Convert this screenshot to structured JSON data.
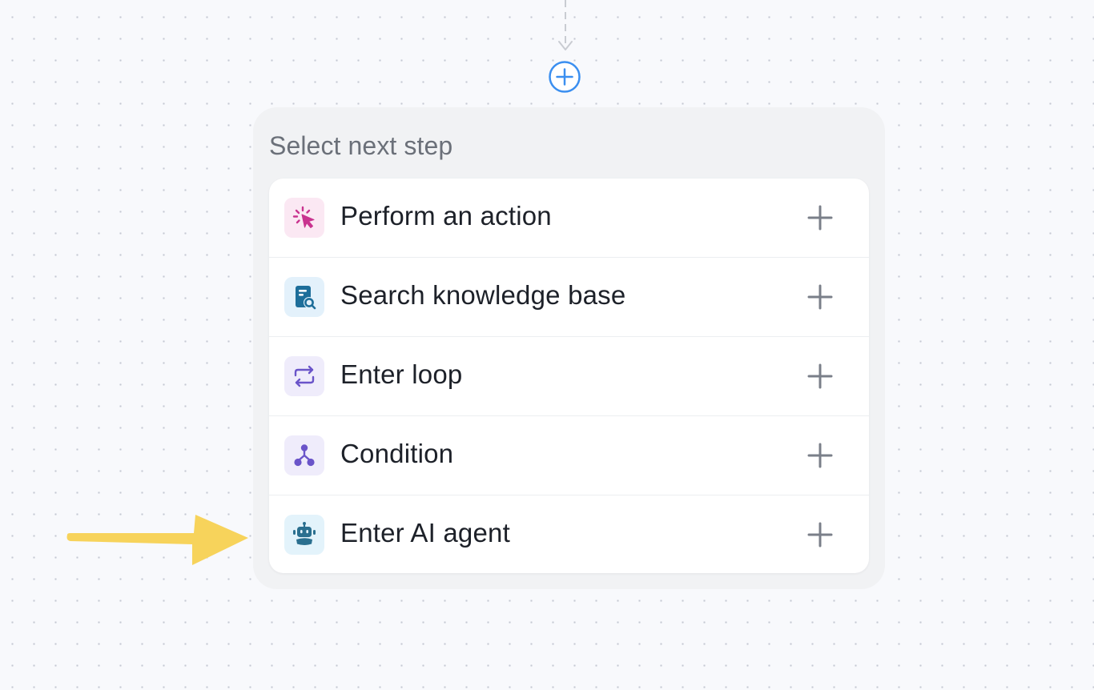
{
  "panel": {
    "title": "Select next step"
  },
  "steps": [
    {
      "label": "Perform an action",
      "icon": "cursor-click-icon",
      "tile_color": "#fbe8f3",
      "icon_color": "#c9338f"
    },
    {
      "label": "Search knowledge base",
      "icon": "knowledge-base-icon",
      "tile_color": "#e3f1fb",
      "icon_color": "#1d6e9a"
    },
    {
      "label": "Enter loop",
      "icon": "loop-icon",
      "tile_color": "#efecfb",
      "icon_color": "#6a54c9"
    },
    {
      "label": "Condition",
      "icon": "branch-icon",
      "tile_color": "#efecfb",
      "icon_color": "#6a54c9"
    },
    {
      "label": "Enter AI agent",
      "icon": "robot-icon",
      "tile_color": "#e3f3fb",
      "icon_color": "#2a6f8f"
    }
  ],
  "colors": {
    "accent": "#3b8ff0",
    "plus": "#7a7f89",
    "highlight_arrow": "#f7d35b"
  }
}
